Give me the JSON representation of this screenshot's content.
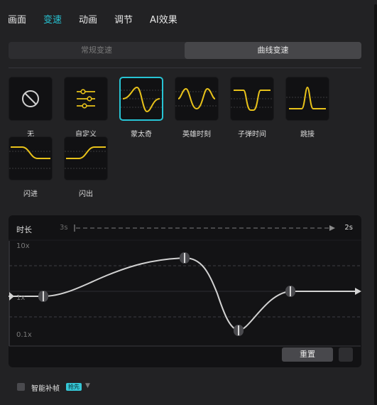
{
  "tabs": [
    {
      "label": "画面",
      "active": false
    },
    {
      "label": "变速",
      "active": true
    },
    {
      "label": "动画",
      "active": false
    },
    {
      "label": "调节",
      "active": false
    },
    {
      "label": "AI效果",
      "active": false
    }
  ],
  "segment": {
    "normal": "常规变速",
    "curve": "曲线变速",
    "selected": "curve"
  },
  "presets": [
    {
      "label": "无",
      "icon": "none-icon"
    },
    {
      "label": "自定义",
      "icon": "sliders-icon"
    },
    {
      "label": "蒙太奇",
      "icon": "montage-curve-icon",
      "selected": true
    },
    {
      "label": "英雄时刻",
      "icon": "hero-moment-curve-icon"
    },
    {
      "label": "子弹时间",
      "icon": "bullet-time-curve-icon"
    },
    {
      "label": "跳接",
      "icon": "jump-cut-curve-icon"
    },
    {
      "label": "闪进",
      "icon": "flash-in-curve-icon"
    },
    {
      "label": "闪出",
      "icon": "flash-out-curve-icon"
    }
  ],
  "curve_panel": {
    "duration_label": "时长",
    "from": "3s",
    "to": "2s",
    "y_labels": {
      "top": "10x",
      "mid": "1x",
      "bottom": "0.1x"
    },
    "reset_label": "重置"
  },
  "smart_interp": {
    "label": "智能补帧",
    "badge": "抢先",
    "checked": false
  },
  "colors": {
    "accent": "#27c4d4",
    "curve_yellow": "#e8c21a",
    "badge": "#35c7d6"
  }
}
